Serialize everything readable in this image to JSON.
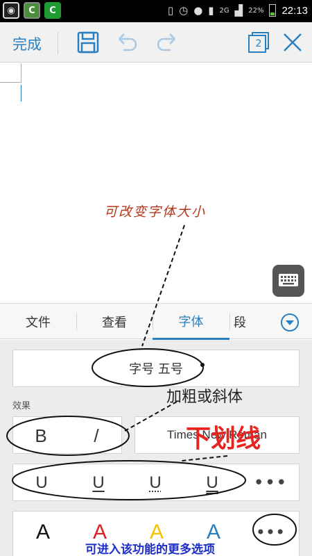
{
  "status_bar": {
    "battery_pct": "22%",
    "time": "22:13",
    "network": "2G",
    "icons": [
      "camera-icon",
      "green-app-icon",
      "green-app-icon",
      "vibrate-icon",
      "alarm-icon",
      "contacts-icon",
      "sim-icon",
      "signal-icon",
      "battery-icon"
    ]
  },
  "toolbar": {
    "done_label": "完成",
    "page_count": "2",
    "icons": [
      "save-icon",
      "undo-icon",
      "redo-icon",
      "pages-icon",
      "close-icon"
    ]
  },
  "tabs": [
    {
      "label": "文件"
    },
    {
      "label": "查看"
    },
    {
      "label": "字体",
      "active": true
    },
    {
      "label": "段"
    }
  ],
  "panel": {
    "font_size_label": "字号  五号",
    "effects_label": "效果",
    "bold_label": "B",
    "italic_label": "/",
    "font_name": "Times New Roman",
    "underline_buttons": [
      "U",
      "U",
      "U",
      "U"
    ],
    "underline_more": "•••",
    "color_buttons": [
      {
        "label": "A",
        "color": "#111111"
      },
      {
        "label": "A",
        "color": "#e02020"
      },
      {
        "label": "A",
        "color": "#f4c400"
      },
      {
        "label": "A",
        "color": "#2a7fc0"
      }
    ],
    "color_more": "•••"
  },
  "annotations": {
    "font_size_note": "可改变字体大小",
    "bold_italic_note": "加粗或斜体",
    "underline_note": "下划线",
    "more_options_note": "可进入该功能的更多选项"
  },
  "colors": {
    "accent": "#2a7fc0",
    "status_bar": "#000000",
    "panel_bg": "#ececec"
  }
}
